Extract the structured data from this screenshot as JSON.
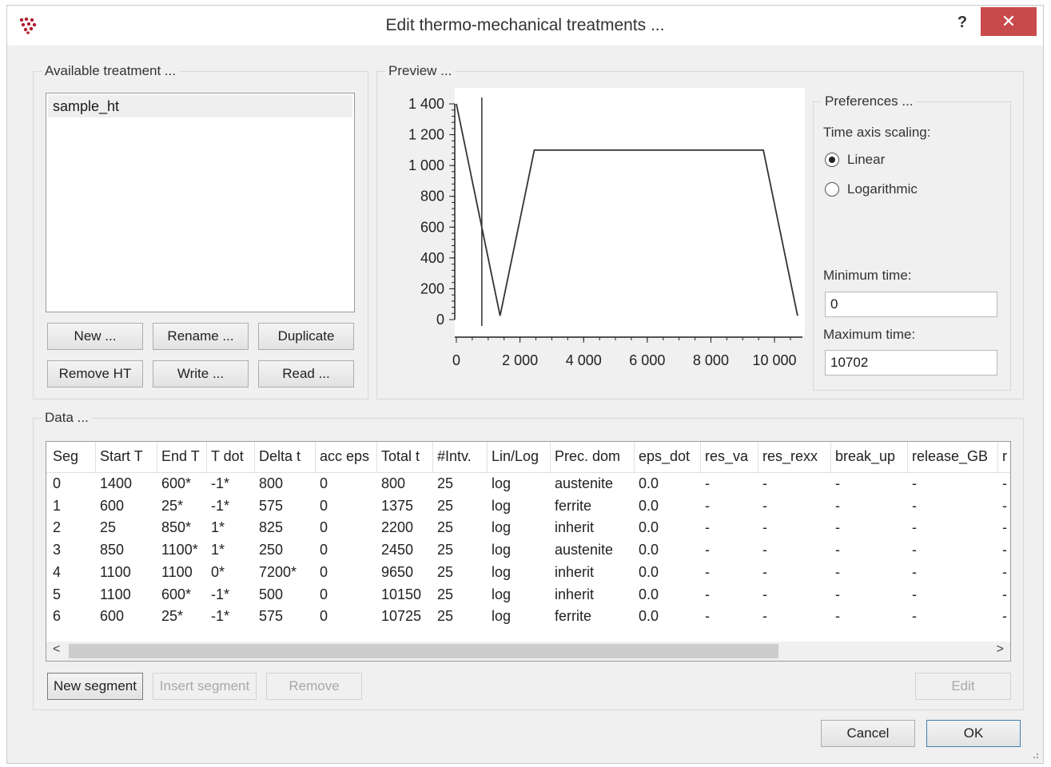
{
  "window": {
    "title": "Edit thermo-mechanical treatments ...",
    "help": "?",
    "close": "✕"
  },
  "available": {
    "title": "Available treatment ...",
    "items": [
      "sample_ht"
    ],
    "buttons": {
      "new": "New ...",
      "rename": "Rename ...",
      "duplicate": "Duplicate",
      "remove_ht": "Remove HT",
      "write": "Write ...",
      "read": "Read ..."
    }
  },
  "preview": {
    "title": "Preview ...",
    "y_ticks": [
      "1 400",
      "1 200",
      "1 000",
      "800",
      "600",
      "400",
      "200",
      "0"
    ],
    "x_ticks": [
      "0",
      "2 000",
      "4 000",
      "6 000",
      "8 000",
      "10 000"
    ],
    "marker_time": 800
  },
  "chart_data": {
    "type": "line",
    "x": [
      0,
      800,
      1375,
      2200,
      2450,
      9650,
      10150,
      10725
    ],
    "series": [
      {
        "values": [
          1400,
          600,
          25,
          850,
          1100,
          1100,
          600,
          25
        ]
      }
    ],
    "xlim": [
      0,
      10702
    ],
    "ylim": [
      0,
      1400
    ]
  },
  "preferences": {
    "title": "Preferences ...",
    "time_axis_label": "Time axis scaling:",
    "linear": "Linear",
    "logarithmic": "Logarithmic",
    "selected": "Linear",
    "min_time_label": "Minimum time:",
    "min_time": "0",
    "max_time_label": "Maximum time:",
    "max_time": "10702"
  },
  "data": {
    "title": "Data ...",
    "columns": [
      "Seg",
      "Start T",
      "End T",
      "T dot",
      "Delta t",
      "acc eps",
      "Total t",
      "#Intv.",
      "Lin/Log",
      "Prec. dom",
      "eps_dot",
      "res_va",
      "res_rexx",
      "break_up",
      "release_GB",
      "r"
    ],
    "rows": [
      [
        "0",
        "1400",
        "600*",
        "-1*",
        "800",
        "0",
        "800",
        "25",
        "log",
        "austenite",
        "0.0",
        "-",
        "-",
        "-",
        "-",
        "-"
      ],
      [
        "1",
        "600",
        "25*",
        "-1*",
        "575",
        "0",
        "1375",
        "25",
        "log",
        "ferrite",
        "0.0",
        "-",
        "-",
        "-",
        "-",
        "-"
      ],
      [
        "2",
        "25",
        "850*",
        "1*",
        "825",
        "0",
        "2200",
        "25",
        "log",
        "inherit",
        "0.0",
        "-",
        "-",
        "-",
        "-",
        "-"
      ],
      [
        "3",
        "850",
        "1100*",
        "1*",
        "250",
        "0",
        "2450",
        "25",
        "log",
        "austenite",
        "0.0",
        "-",
        "-",
        "-",
        "-",
        "-"
      ],
      [
        "4",
        "1100",
        "1100",
        "0*",
        "7200*",
        "0",
        "9650",
        "25",
        "log",
        "inherit",
        "0.0",
        "-",
        "-",
        "-",
        "-",
        "-"
      ],
      [
        "5",
        "1100",
        "600*",
        "-1*",
        "500",
        "0",
        "10150",
        "25",
        "log",
        "inherit",
        "0.0",
        "-",
        "-",
        "-",
        "-",
        "-"
      ],
      [
        "6",
        "600",
        "25*",
        "-1*",
        "575",
        "0",
        "10725",
        "25",
        "log",
        "ferrite",
        "0.0",
        "-",
        "-",
        "-",
        "-",
        "-"
      ]
    ],
    "buttons": {
      "new_segment": "New segment",
      "insert_segment": "Insert segment",
      "remove": "Remove",
      "edit": "Edit"
    }
  },
  "footer": {
    "cancel": "Cancel",
    "ok": "OK"
  },
  "colors": {
    "close": "#c94a4a",
    "ok_border": "#3c7fb1",
    "plot_line": "#333333"
  }
}
